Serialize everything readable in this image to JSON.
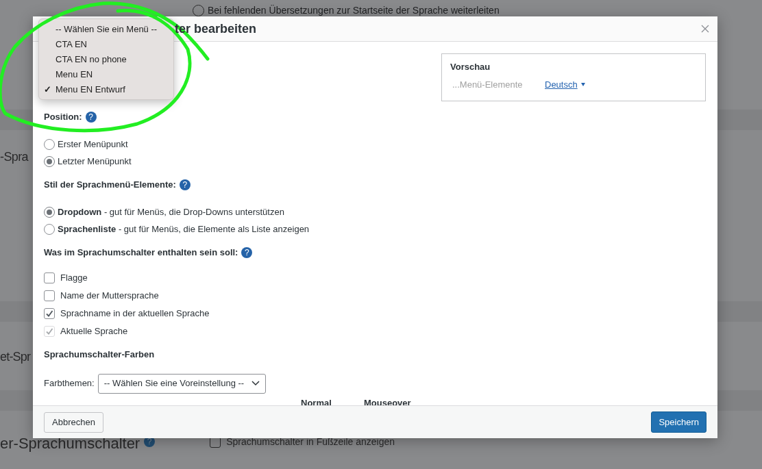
{
  "background": {
    "redirect_option": {
      "label": "Bei fehlenden Übersetzungen zur Startseite der Sprache weiterleiten",
      "selected": false
    },
    "section_labels": [
      "-Spra",
      "et-Spr"
    ],
    "footer_setting": {
      "label": "er-Sprachumschalter",
      "help": "?",
      "checkbox": {
        "label": "Sprachumschalter in Fußzeile anzeigen",
        "checked": false
      }
    }
  },
  "menu_dropdown": {
    "options": [
      {
        "label": "-- Wählen Sie ein Menü --",
        "selected": false
      },
      {
        "label": "CTA EN",
        "selected": false
      },
      {
        "label": "CTA EN no phone",
        "selected": false
      },
      {
        "label": "Menu EN",
        "selected": false
      },
      {
        "label": "Menu EN Entwurf",
        "selected": true
      }
    ],
    "check": "✓"
  },
  "dialog": {
    "title": "ter bearbeiten",
    "preview": {
      "title": "Vorschau",
      "items_label": "...Menü-Elemente",
      "language_link": "Deutsch"
    },
    "sections": [
      {
        "kind": "radio",
        "heading": "Position:",
        "help": "?",
        "options": [
          {
            "label": "Erster Menüpunkt",
            "selected": false
          },
          {
            "label": "Letzter Menüpunkt",
            "selected": true
          }
        ]
      },
      {
        "kind": "radio",
        "heading": "Stil der Sprachmenü-Elemente:",
        "help": "?",
        "options": [
          {
            "label": "**Dropdown** - gut für Menüs, die Drop-Downs unterstützen",
            "selected": true
          },
          {
            "label": "**Sprachenliste** - gut für Menüs, die Elemente als Liste anzeigen",
            "selected": false
          }
        ]
      },
      {
        "kind": "checkbox",
        "heading": "Was im Sprachumschalter enthalten sein soll:",
        "help": "?",
        "options": [
          {
            "label": "Flagge",
            "checked": false,
            "disabled": false
          },
          {
            "label": "Name der Muttersprache",
            "checked": false,
            "disabled": false
          },
          {
            "label": "Sprachname in der aktuellen Sprache",
            "checked": true,
            "disabled": false
          },
          {
            "label": "Aktuelle Sprache",
            "checked": true,
            "disabled": true
          }
        ]
      }
    ],
    "colors": {
      "heading": "Sprachumschalter-Farben",
      "theme_label": "Farbthemen:",
      "theme_value": "-- Wählen Sie eine Voreinstellung --",
      "columns": [
        "Normal",
        "Mouseover"
      ]
    },
    "buttons": {
      "cancel": "Abbrechen",
      "save": "Speichern"
    }
  }
}
